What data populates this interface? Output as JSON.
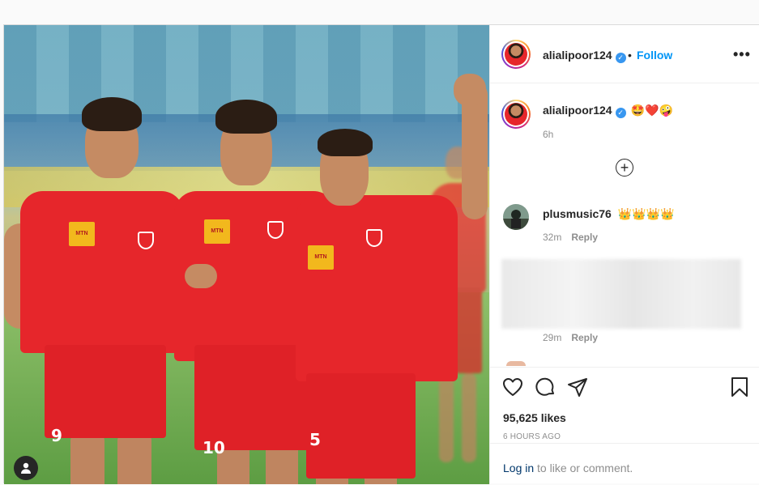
{
  "post": {
    "username": "alialipoor124",
    "verified_mark": "✓",
    "separator": "•",
    "follow_label": "Follow",
    "more_label": "•••"
  },
  "caption": {
    "username": "alialipoor124",
    "text": "🤩❤️🤪",
    "time": "6h"
  },
  "load_more_label": "+",
  "comments": [
    {
      "username": "plusmusic76",
      "text": "👑👑👑👑",
      "time": "32m",
      "reply_label": "Reply"
    },
    {
      "username": "",
      "text": "",
      "time": "29m",
      "reply_label": "Reply"
    }
  ],
  "photo": {
    "jersey_numbers": [
      "9",
      "10",
      "5"
    ],
    "sponsor_text": "MTN"
  },
  "likes": "95,625 likes",
  "posted_ago": "6 HOURS AGO",
  "login": {
    "link_label": "Log in",
    "rest": " to like or comment."
  },
  "icons": [
    "heart-icon",
    "comment-icon",
    "share-icon",
    "bookmark-icon",
    "more-icon",
    "verified-icon",
    "user-icon"
  ],
  "colors": {
    "follow": "#0095f6",
    "verified": "#3897f0",
    "jersey": "#e6262b"
  }
}
